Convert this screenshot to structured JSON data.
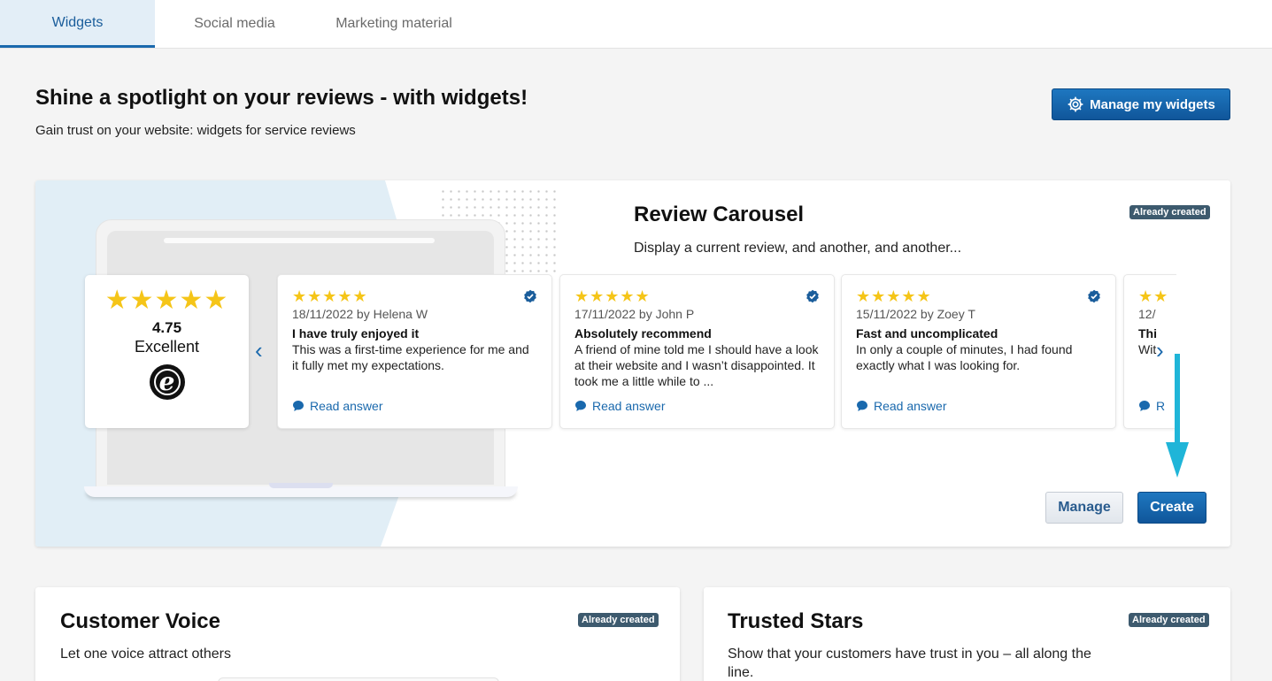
{
  "tabs": [
    {
      "label": "Widgets",
      "active": true
    },
    {
      "label": "Social media",
      "active": false
    },
    {
      "label": "Marketing material",
      "active": false
    }
  ],
  "header": {
    "title": "Shine a spotlight on your reviews - with widgets!",
    "subtitle": "Gain trust on your website: widgets for service reviews",
    "manage_widgets_label": "Manage my widgets",
    "manage_widgets_icon": "gear-icon"
  },
  "colors": {
    "accent": "#1a69ad",
    "star": "#f5c518",
    "badge": "#3d5a6e",
    "pointer_arrow": "#1fb5d8",
    "illustration_bg": "#e1eef6"
  },
  "review_carousel": {
    "title": "Review Carousel",
    "badge": "Already created",
    "description": "Display a current review, and another, and another...",
    "rating": {
      "stars": "★★★★★",
      "score": "4.75",
      "label": "Excellent",
      "logo_letter": "e"
    },
    "reviews": [
      {
        "stars": "★★★★★",
        "date_author": "18/11/2022 by Helena W",
        "title": "I have truly enjoyed it",
        "text": "This was a first-time experience for me and it fully met my expectations.",
        "answer_label": "Read answer"
      },
      {
        "stars": "★★★★★",
        "date_author": "17/11/2022 by John P",
        "title": "Absolutely recommend",
        "text": "A friend of mine told me I should have a look at their website and I wasn’t disappointed. It took me a little while to ...",
        "answer_label": "Read answer"
      },
      {
        "stars": "★★★★★",
        "date_author": "15/11/2022 by Zoey T",
        "title": "Fast and uncomplicated",
        "text": "In only a couple of minutes, I had found exactly what I was looking for.",
        "answer_label": "Read answer"
      },
      {
        "stars": "★★",
        "date_author": "12/",
        "title": "Thi",
        "text": "Wit",
        "answer_label": "R"
      }
    ],
    "prev_arrow": "‹",
    "next_arrow": "›",
    "manage_label": "Manage",
    "create_label": "Create"
  },
  "customer_voice": {
    "title": "Customer Voice",
    "badge": "Already created",
    "description": "Let one voice attract others"
  },
  "trusted_stars": {
    "title": "Trusted Stars",
    "badge": "Already created",
    "description": "Show that your customers have trust in you – all along the line."
  }
}
